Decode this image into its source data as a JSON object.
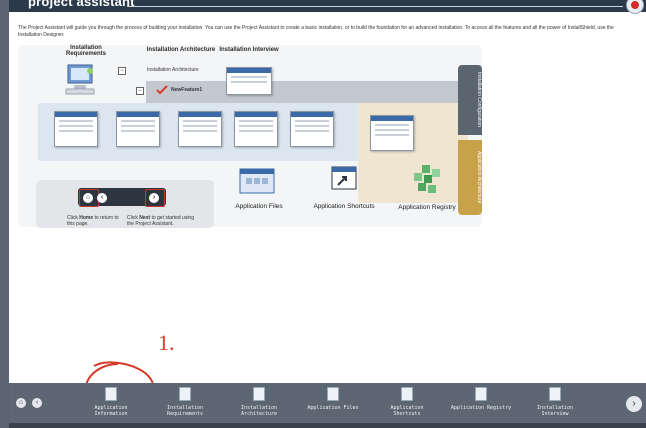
{
  "app": {
    "title": "project assistant"
  },
  "intro": "The Project Assistant will guide you through the process of building your installation. You can use the Project Assistant to create a basic installation, or to build the foundation for an advanced installation. To access all the features and all the power of InstallShield, use the Installation Designer.",
  "diagram": {
    "labels": {
      "installation_requirements": "Installation Requirements",
      "installation_architecture": "Installation Architecture",
      "installation_interview": "Installation Interview"
    },
    "tree": {
      "root": "Installation Architecture",
      "child": "NewFeature1"
    },
    "side_tabs": {
      "configuration": "Installation Configuration",
      "architecture": "Application Architecture"
    },
    "captions": {
      "files": "Application Files",
      "shortcuts": "Application Shortcuts",
      "registry": "Application Registry"
    },
    "nav_help": {
      "home_prefix": "Click ",
      "home_bold": "Home",
      "home_suffix": " to return to this page.",
      "next_prefix": "Click ",
      "next_bold": "Next",
      "next_suffix": " to get started using the Project Assistant."
    }
  },
  "annotation": {
    "number": "1."
  },
  "bottom_bar": {
    "items": [
      {
        "label": "Application Information"
      },
      {
        "label": "Installation Requirements"
      },
      {
        "label": "Installation Architecture"
      },
      {
        "label": "Application Files"
      },
      {
        "label": "Application Shortcuts"
      },
      {
        "label": "Application Registry"
      },
      {
        "label": "Installation Interview"
      }
    ]
  },
  "colors": {
    "header": "#2b3a4a",
    "bottom_bar": "#5d6773",
    "accent_red": "#d83a2a",
    "tab_gold": "#c7a24a",
    "tab_slate": "#5b6570"
  },
  "icons": [
    "home-icon",
    "back-arrow-icon",
    "next-arrow-icon",
    "document-icon",
    "computer-icon",
    "registry-cubes-icon",
    "shortcut-icon"
  ]
}
